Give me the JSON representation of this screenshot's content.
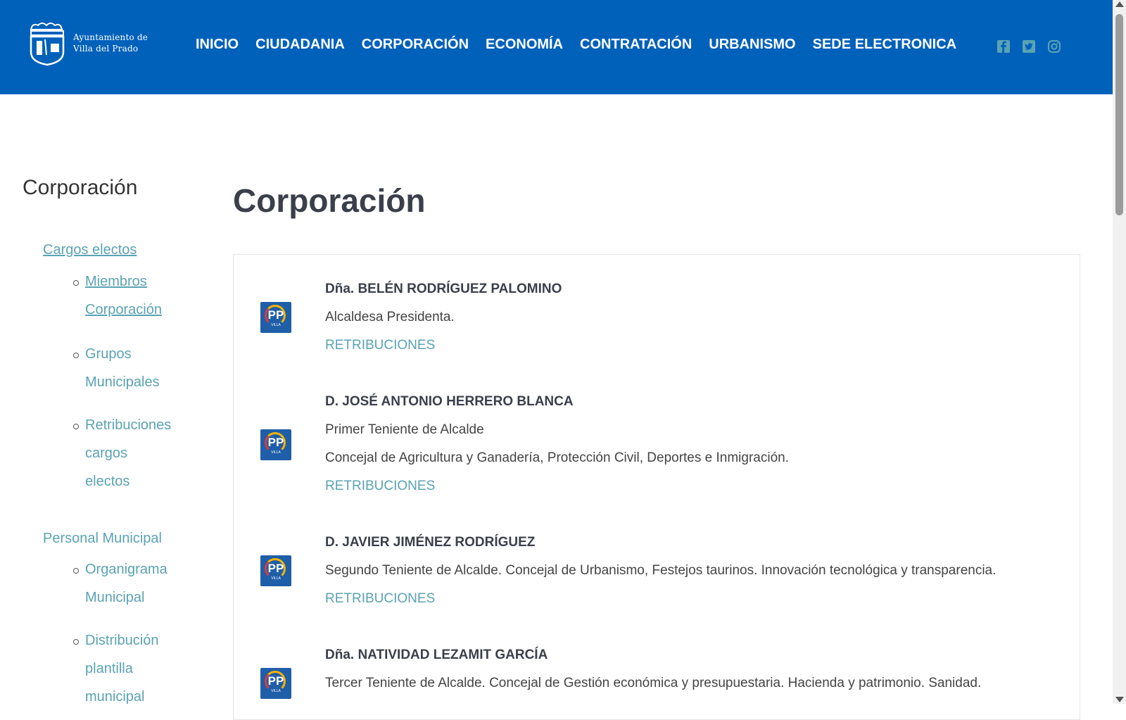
{
  "header": {
    "logo_line1": "Ayuntamiento de",
    "logo_line2": "Villa del Prado",
    "nav": [
      "INICIO",
      "CIUDADANIA",
      "CORPORACIÓN",
      "ECONOMÍA",
      "CONTRATACIÓN",
      "URBANISMO",
      "SEDE ELECTRONICA"
    ],
    "social_icons": [
      "facebook-icon",
      "twitter-icon",
      "instagram-icon"
    ],
    "bg_color": "#0061bb"
  },
  "sidebar": {
    "title": "Corporación",
    "sections": [
      {
        "label": "Cargos electos",
        "items": [
          [
            "Miembros",
            "Corporación"
          ],
          [
            "Grupos",
            "Municipales"
          ],
          [
            "Retribuciones",
            "cargos",
            "electos"
          ]
        ]
      },
      {
        "label": "Personal Municipal",
        "items": [
          [
            "Organigrama",
            "Municipal"
          ],
          [
            "Distribución",
            "plantilla",
            "municipal"
          ]
        ]
      }
    ]
  },
  "main": {
    "title": "Corporación",
    "party_logo": {
      "text": "PP",
      "sub1": "VILLA",
      "sub2": "DEL PRADO"
    },
    "members": [
      {
        "name": "Dña. BELÉN RODRÍGUEZ PALOMINO",
        "lines": [
          "Alcaldesa Presidenta."
        ],
        "link": "RETRIBUCIONES"
      },
      {
        "name": "D. JOSÉ ANTONIO HERRERO BLANCA",
        "lines": [
          "Primer Teniente de Alcalde",
          "Concejal de Agricultura y Ganadería, Protección Civil, Deportes e Inmigración."
        ],
        "link": "RETRIBUCIONES"
      },
      {
        "name": "D. JAVIER JIMÉNEZ RODRÍGUEZ",
        "lines": [
          "Segundo Teniente de Alcalde. Concejal de Urbanismo,  Festejos taurinos. Innovación tecnológica y transparencia."
        ],
        "link": "RETRIBUCIONES"
      },
      {
        "name": "Dña. NATIVIDAD LEZAMIT GARCÍA",
        "lines": [
          "Tercer Teniente de Alcalde. Concejal de Gestión económica y presupuestaria. Hacienda y patrimonio. Sanidad."
        ],
        "link": ""
      }
    ]
  }
}
